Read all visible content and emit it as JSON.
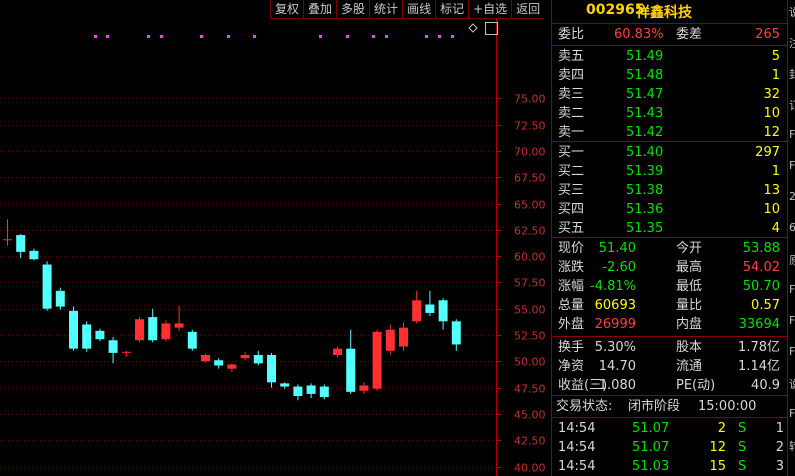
{
  "toolbar": [
    "复权",
    "叠加",
    "多股",
    "统计",
    "画线",
    "标记",
    "+自选",
    "返回"
  ],
  "stock": {
    "code": "002965",
    "name": "祥鑫科技"
  },
  "weibi": {
    "label1": "委比",
    "value1": "60.83%",
    "label2": "委差",
    "value2": "265"
  },
  "asks": [
    {
      "label": "卖五",
      "price": "51.49",
      "vol": "5"
    },
    {
      "label": "卖四",
      "price": "51.48",
      "vol": "1"
    },
    {
      "label": "卖三",
      "price": "51.47",
      "vol": "32"
    },
    {
      "label": "卖二",
      "price": "51.43",
      "vol": "10"
    },
    {
      "label": "卖一",
      "price": "51.42",
      "vol": "12"
    }
  ],
  "bids": [
    {
      "label": "买一",
      "price": "51.40",
      "vol": "297"
    },
    {
      "label": "买二",
      "price": "51.39",
      "vol": "1"
    },
    {
      "label": "买三",
      "price": "51.38",
      "vol": "13"
    },
    {
      "label": "买四",
      "price": "51.36",
      "vol": "10"
    },
    {
      "label": "买五",
      "price": "51.35",
      "vol": "4"
    }
  ],
  "stats": [
    {
      "l1": "现价",
      "v1": "51.40",
      "c1": "green",
      "l2": "今开",
      "v2": "53.88",
      "c2": "green"
    },
    {
      "l1": "涨跌",
      "v1": "-2.60",
      "c1": "green",
      "l2": "最高",
      "v2": "54.02",
      "c2": "red"
    },
    {
      "l1": "涨幅",
      "v1": "-4.81%",
      "c1": "green",
      "l2": "最低",
      "v2": "50.70",
      "c2": "green"
    },
    {
      "l1": "总量",
      "v1": "60693",
      "c1": "yellow",
      "l2": "量比",
      "v2": "0.57",
      "c2": "yellow"
    },
    {
      "l1": "外盘",
      "v1": "26999",
      "c1": "red",
      "l2": "内盘",
      "v2": "33694",
      "c2": "green"
    }
  ],
  "stats2": [
    {
      "l1": "换手",
      "v1": "5.30%",
      "l2": "股本",
      "v2": "1.78亿"
    },
    {
      "l1": "净资",
      "v1": "14.70",
      "l2": "流通",
      "v2": "1.14亿"
    },
    {
      "l1": "收益(三)",
      "v1": "1.080",
      "l2": "PE(动)",
      "v2": "40.9"
    }
  ],
  "trade_status": {
    "label": "交易状态:",
    "value": "闭市阶段",
    "time": "15:00:00"
  },
  "ticks": [
    {
      "time": "14:54",
      "price": "51.07",
      "vol": "2",
      "side": "S",
      "n": "1"
    },
    {
      "time": "14:54",
      "price": "51.07",
      "vol": "12",
      "side": "S",
      "n": "2"
    },
    {
      "time": "14:54",
      "price": "51.03",
      "vol": "15",
      "side": "S",
      "n": "3"
    }
  ],
  "edge_chars": [
    "说",
    "注",
    "封",
    "订",
    "F",
    "F",
    "2",
    "6",
    "原",
    "F",
    "F",
    "F",
    "说",
    "F",
    "转"
  ],
  "chart_data": {
    "type": "candlestick",
    "y_ticks": [
      75.0,
      72.5,
      70.0,
      67.5,
      65.0,
      62.5,
      60.0,
      57.5,
      55.0,
      52.5,
      50.0,
      47.5,
      45.0,
      42.5,
      40.0
    ],
    "ylim": [
      40.0,
      77.5
    ],
    "up_color": "#ff3030",
    "down_color": "#54ffff",
    "candles": [
      {
        "o": 61.6,
        "c": 61.6,
        "h": 63.5,
        "l": 61.0
      },
      {
        "o": 62.0,
        "c": 60.4,
        "h": 62.1,
        "l": 59.8
      },
      {
        "o": 60.5,
        "c": 59.7,
        "h": 60.7,
        "l": 59.6
      },
      {
        "o": 59.2,
        "c": 55.0,
        "h": 59.5,
        "l": 54.8
      },
      {
        "o": 56.7,
        "c": 55.2,
        "h": 57.0,
        "l": 54.9
      },
      {
        "o": 54.8,
        "c": 51.2,
        "h": 55.2,
        "l": 51.0
      },
      {
        "o": 53.5,
        "c": 51.2,
        "h": 53.8,
        "l": 50.9
      },
      {
        "o": 52.9,
        "c": 52.1,
        "h": 53.1,
        "l": 51.9
      },
      {
        "o": 52.0,
        "c": 50.8,
        "h": 52.3,
        "l": 49.8
      },
      {
        "o": 50.9,
        "c": 50.9,
        "h": 51.0,
        "l": 50.4
      },
      {
        "o": 52.0,
        "c": 54.0,
        "h": 54.2,
        "l": 51.8
      },
      {
        "o": 54.2,
        "c": 52.0,
        "h": 55.0,
        "l": 51.8
      },
      {
        "o": 52.1,
        "c": 53.6,
        "h": 53.9,
        "l": 51.9
      },
      {
        "o": 53.2,
        "c": 53.6,
        "h": 55.3,
        "l": 52.9
      },
      {
        "o": 52.8,
        "c": 51.2,
        "h": 53.0,
        "l": 51.0
      },
      {
        "o": 50.0,
        "c": 50.6,
        "h": 50.7,
        "l": 49.9
      },
      {
        "o": 50.1,
        "c": 49.6,
        "h": 50.3,
        "l": 49.3
      },
      {
        "o": 49.3,
        "c": 49.7,
        "h": 49.8,
        "l": 49.0
      },
      {
        "o": 50.3,
        "c": 50.6,
        "h": 50.9,
        "l": 50.1
      },
      {
        "o": 50.6,
        "c": 49.8,
        "h": 51.0,
        "l": 49.6
      },
      {
        "o": 50.6,
        "c": 48.0,
        "h": 50.8,
        "l": 47.5
      },
      {
        "o": 47.9,
        "c": 47.6,
        "h": 48.0,
        "l": 47.4
      },
      {
        "o": 47.6,
        "c": 46.7,
        "h": 47.8,
        "l": 46.3
      },
      {
        "o": 47.7,
        "c": 46.9,
        "h": 47.9,
        "l": 46.5
      },
      {
        "o": 47.6,
        "c": 46.6,
        "h": 47.8,
        "l": 46.4
      },
      {
        "o": 50.6,
        "c": 51.2,
        "h": 51.4,
        "l": 50.4
      },
      {
        "o": 51.2,
        "c": 47.1,
        "h": 53.0,
        "l": 46.9
      },
      {
        "o": 47.2,
        "c": 47.7,
        "h": 48.0,
        "l": 46.9
      },
      {
        "o": 47.4,
        "c": 52.8,
        "h": 53.0,
        "l": 47.2
      },
      {
        "o": 51.0,
        "c": 53.0,
        "h": 53.5,
        "l": 50.6
      },
      {
        "o": 51.4,
        "c": 53.2,
        "h": 53.7,
        "l": 51.0
      },
      {
        "o": 53.8,
        "c": 55.8,
        "h": 56.7,
        "l": 53.6
      },
      {
        "o": 55.4,
        "c": 54.6,
        "h": 56.7,
        "l": 54.3
      },
      {
        "o": 55.8,
        "c": 53.8,
        "h": 56.0,
        "l": 53.0
      },
      {
        "o": 53.8,
        "c": 51.6,
        "h": 54.0,
        "l": 51.0
      }
    ],
    "markers_count": 14
  }
}
